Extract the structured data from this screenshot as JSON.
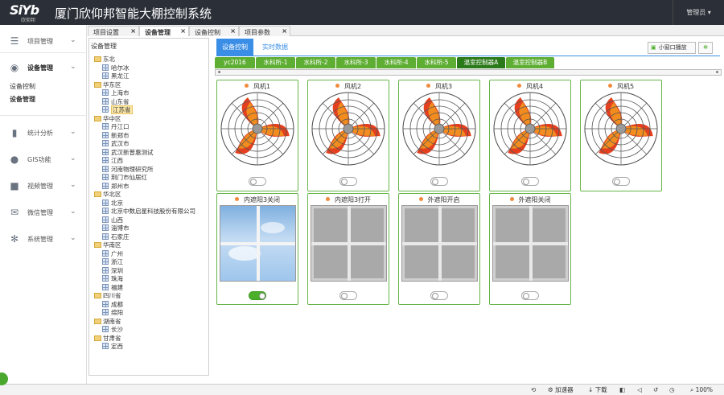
{
  "app": {
    "logo": "SiYb",
    "logo_sub": "欣仰邦",
    "title": "厦门欣仰邦智能大棚控制系统",
    "user": "管理员"
  },
  "sidebar": {
    "items": [
      {
        "label": "项目管理",
        "icon": "list-icon"
      },
      {
        "label": "设备管理",
        "icon": "globe-icon"
      },
      {
        "label": "统计分析",
        "icon": "bar-chart-icon"
      },
      {
        "label": "GIS功能",
        "icon": "map-pin-icon"
      },
      {
        "label": "视频管理",
        "icon": "video-icon"
      },
      {
        "label": "微信管理",
        "icon": "mail-icon"
      },
      {
        "label": "系统管理",
        "icon": "gear-icon"
      }
    ],
    "subitems": [
      "设备控制",
      "设备管理"
    ]
  },
  "tabs": [
    {
      "label": "项目设置"
    },
    {
      "label": "设备管理"
    },
    {
      "label": "设备控制"
    },
    {
      "label": "项目参数"
    }
  ],
  "tree": {
    "header": "设备管理",
    "nodes": [
      {
        "label": "东北",
        "type": "folder"
      },
      {
        "label": "哈尔冰",
        "type": "device"
      },
      {
        "label": "黑龙江",
        "type": "device"
      },
      {
        "label": "华东区",
        "type": "folder"
      },
      {
        "label": "上海市",
        "type": "device"
      },
      {
        "label": "山东省",
        "type": "device"
      },
      {
        "label": "江苏省",
        "type": "device",
        "selected": true
      },
      {
        "label": "华中区",
        "type": "folder"
      },
      {
        "label": "丹江口",
        "type": "device"
      },
      {
        "label": "新郑市",
        "type": "device"
      },
      {
        "label": "武汉市",
        "type": "device"
      },
      {
        "label": "武汉新普惠测试",
        "type": "device"
      },
      {
        "label": "江西",
        "type": "device"
      },
      {
        "label": "河南物理研究所",
        "type": "device"
      },
      {
        "label": "荆门市仙居红",
        "type": "device"
      },
      {
        "label": "郑州市",
        "type": "device"
      },
      {
        "label": "华北区",
        "type": "folder"
      },
      {
        "label": "北京",
        "type": "device"
      },
      {
        "label": "北京中数启星科技股份有限公司",
        "type": "device"
      },
      {
        "label": "山西",
        "type": "device"
      },
      {
        "label": "淄博市",
        "type": "device"
      },
      {
        "label": "石家庄",
        "type": "device"
      },
      {
        "label": "华南区",
        "type": "folder"
      },
      {
        "label": "广州",
        "type": "device"
      },
      {
        "label": "浙江",
        "type": "device"
      },
      {
        "label": "深圳",
        "type": "device"
      },
      {
        "label": "珠海",
        "type": "device"
      },
      {
        "label": "福建",
        "type": "device"
      },
      {
        "label": "四川省",
        "type": "folder"
      },
      {
        "label": "成都",
        "type": "device"
      },
      {
        "label": "绵阳",
        "type": "device"
      },
      {
        "label": "湖南省",
        "type": "folder"
      },
      {
        "label": "长沙",
        "type": "device"
      },
      {
        "label": "甘肃省",
        "type": "folder"
      },
      {
        "label": "定西",
        "type": "device"
      }
    ]
  },
  "main": {
    "subtabs": [
      "设备控制",
      "实时数据"
    ],
    "popup_button": "小窗口播放",
    "controller_tabs": [
      "yc2016",
      "水科所-1",
      "水科所-2",
      "水科所-3",
      "水科所-4",
      "水科所-5",
      "温室控制器A",
      "温室控制器B"
    ],
    "fans": [
      {
        "name": "风机1",
        "on": false
      },
      {
        "name": "风机2",
        "on": false
      },
      {
        "name": "风机3",
        "on": false
      },
      {
        "name": "风机4",
        "on": false
      },
      {
        "name": "风机5",
        "on": false
      }
    ],
    "shades": [
      {
        "name": "内遮阳3关闭",
        "on": true,
        "sky": true
      },
      {
        "name": "内遮阳3打开",
        "on": false,
        "sky": false
      },
      {
        "name": "外遮阳开启",
        "on": false,
        "sky": false
      },
      {
        "name": "外遮阳关闭",
        "on": false,
        "sky": false
      }
    ],
    "colors": {
      "accent": "#3a8ee6",
      "green": "#5fae34",
      "fan_orange": "#f28c1e",
      "fan_red": "#e4401f"
    }
  },
  "statusbar": {
    "accelerator": "加速器",
    "download": "下载",
    "zoom": "100%"
  }
}
